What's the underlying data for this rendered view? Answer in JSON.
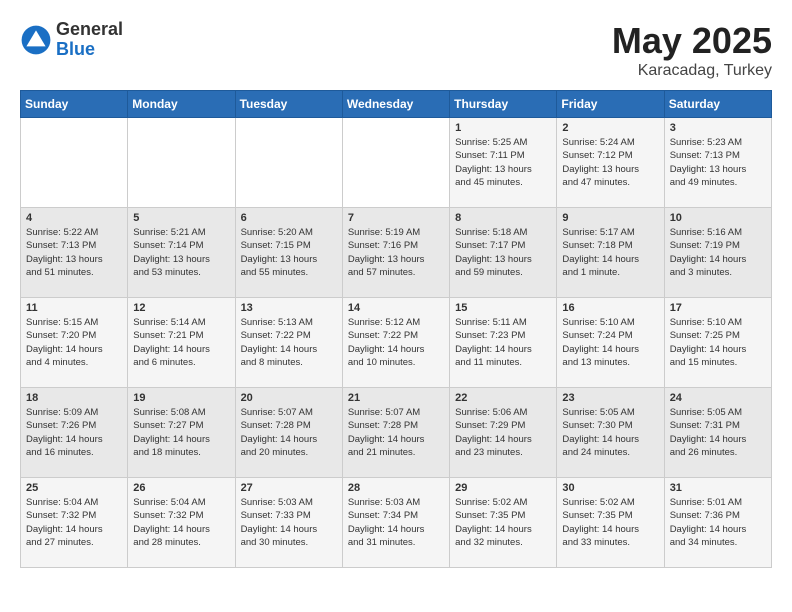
{
  "header": {
    "logo_general": "General",
    "logo_blue": "Blue",
    "title": "May 2025",
    "location": "Karacadag, Turkey"
  },
  "weekdays": [
    "Sunday",
    "Monday",
    "Tuesday",
    "Wednesday",
    "Thursday",
    "Friday",
    "Saturday"
  ],
  "weeks": [
    [
      {
        "day": "",
        "info": ""
      },
      {
        "day": "",
        "info": ""
      },
      {
        "day": "",
        "info": ""
      },
      {
        "day": "",
        "info": ""
      },
      {
        "day": "1",
        "info": "Sunrise: 5:25 AM\nSunset: 7:11 PM\nDaylight: 13 hours\nand 45 minutes."
      },
      {
        "day": "2",
        "info": "Sunrise: 5:24 AM\nSunset: 7:12 PM\nDaylight: 13 hours\nand 47 minutes."
      },
      {
        "day": "3",
        "info": "Sunrise: 5:23 AM\nSunset: 7:13 PM\nDaylight: 13 hours\nand 49 minutes."
      }
    ],
    [
      {
        "day": "4",
        "info": "Sunrise: 5:22 AM\nSunset: 7:13 PM\nDaylight: 13 hours\nand 51 minutes."
      },
      {
        "day": "5",
        "info": "Sunrise: 5:21 AM\nSunset: 7:14 PM\nDaylight: 13 hours\nand 53 minutes."
      },
      {
        "day": "6",
        "info": "Sunrise: 5:20 AM\nSunset: 7:15 PM\nDaylight: 13 hours\nand 55 minutes."
      },
      {
        "day": "7",
        "info": "Sunrise: 5:19 AM\nSunset: 7:16 PM\nDaylight: 13 hours\nand 57 minutes."
      },
      {
        "day": "8",
        "info": "Sunrise: 5:18 AM\nSunset: 7:17 PM\nDaylight: 13 hours\nand 59 minutes."
      },
      {
        "day": "9",
        "info": "Sunrise: 5:17 AM\nSunset: 7:18 PM\nDaylight: 14 hours\nand 1 minute."
      },
      {
        "day": "10",
        "info": "Sunrise: 5:16 AM\nSunset: 7:19 PM\nDaylight: 14 hours\nand 3 minutes."
      }
    ],
    [
      {
        "day": "11",
        "info": "Sunrise: 5:15 AM\nSunset: 7:20 PM\nDaylight: 14 hours\nand 4 minutes."
      },
      {
        "day": "12",
        "info": "Sunrise: 5:14 AM\nSunset: 7:21 PM\nDaylight: 14 hours\nand 6 minutes."
      },
      {
        "day": "13",
        "info": "Sunrise: 5:13 AM\nSunset: 7:22 PM\nDaylight: 14 hours\nand 8 minutes."
      },
      {
        "day": "14",
        "info": "Sunrise: 5:12 AM\nSunset: 7:22 PM\nDaylight: 14 hours\nand 10 minutes."
      },
      {
        "day": "15",
        "info": "Sunrise: 5:11 AM\nSunset: 7:23 PM\nDaylight: 14 hours\nand 11 minutes."
      },
      {
        "day": "16",
        "info": "Sunrise: 5:10 AM\nSunset: 7:24 PM\nDaylight: 14 hours\nand 13 minutes."
      },
      {
        "day": "17",
        "info": "Sunrise: 5:10 AM\nSunset: 7:25 PM\nDaylight: 14 hours\nand 15 minutes."
      }
    ],
    [
      {
        "day": "18",
        "info": "Sunrise: 5:09 AM\nSunset: 7:26 PM\nDaylight: 14 hours\nand 16 minutes."
      },
      {
        "day": "19",
        "info": "Sunrise: 5:08 AM\nSunset: 7:27 PM\nDaylight: 14 hours\nand 18 minutes."
      },
      {
        "day": "20",
        "info": "Sunrise: 5:07 AM\nSunset: 7:28 PM\nDaylight: 14 hours\nand 20 minutes."
      },
      {
        "day": "21",
        "info": "Sunrise: 5:07 AM\nSunset: 7:28 PM\nDaylight: 14 hours\nand 21 minutes."
      },
      {
        "day": "22",
        "info": "Sunrise: 5:06 AM\nSunset: 7:29 PM\nDaylight: 14 hours\nand 23 minutes."
      },
      {
        "day": "23",
        "info": "Sunrise: 5:05 AM\nSunset: 7:30 PM\nDaylight: 14 hours\nand 24 minutes."
      },
      {
        "day": "24",
        "info": "Sunrise: 5:05 AM\nSunset: 7:31 PM\nDaylight: 14 hours\nand 26 minutes."
      }
    ],
    [
      {
        "day": "25",
        "info": "Sunrise: 5:04 AM\nSunset: 7:32 PM\nDaylight: 14 hours\nand 27 minutes."
      },
      {
        "day": "26",
        "info": "Sunrise: 5:04 AM\nSunset: 7:32 PM\nDaylight: 14 hours\nand 28 minutes."
      },
      {
        "day": "27",
        "info": "Sunrise: 5:03 AM\nSunset: 7:33 PM\nDaylight: 14 hours\nand 30 minutes."
      },
      {
        "day": "28",
        "info": "Sunrise: 5:03 AM\nSunset: 7:34 PM\nDaylight: 14 hours\nand 31 minutes."
      },
      {
        "day": "29",
        "info": "Sunrise: 5:02 AM\nSunset: 7:35 PM\nDaylight: 14 hours\nand 32 minutes."
      },
      {
        "day": "30",
        "info": "Sunrise: 5:02 AM\nSunset: 7:35 PM\nDaylight: 14 hours\nand 33 minutes."
      },
      {
        "day": "31",
        "info": "Sunrise: 5:01 AM\nSunset: 7:36 PM\nDaylight: 14 hours\nand 34 minutes."
      }
    ]
  ]
}
